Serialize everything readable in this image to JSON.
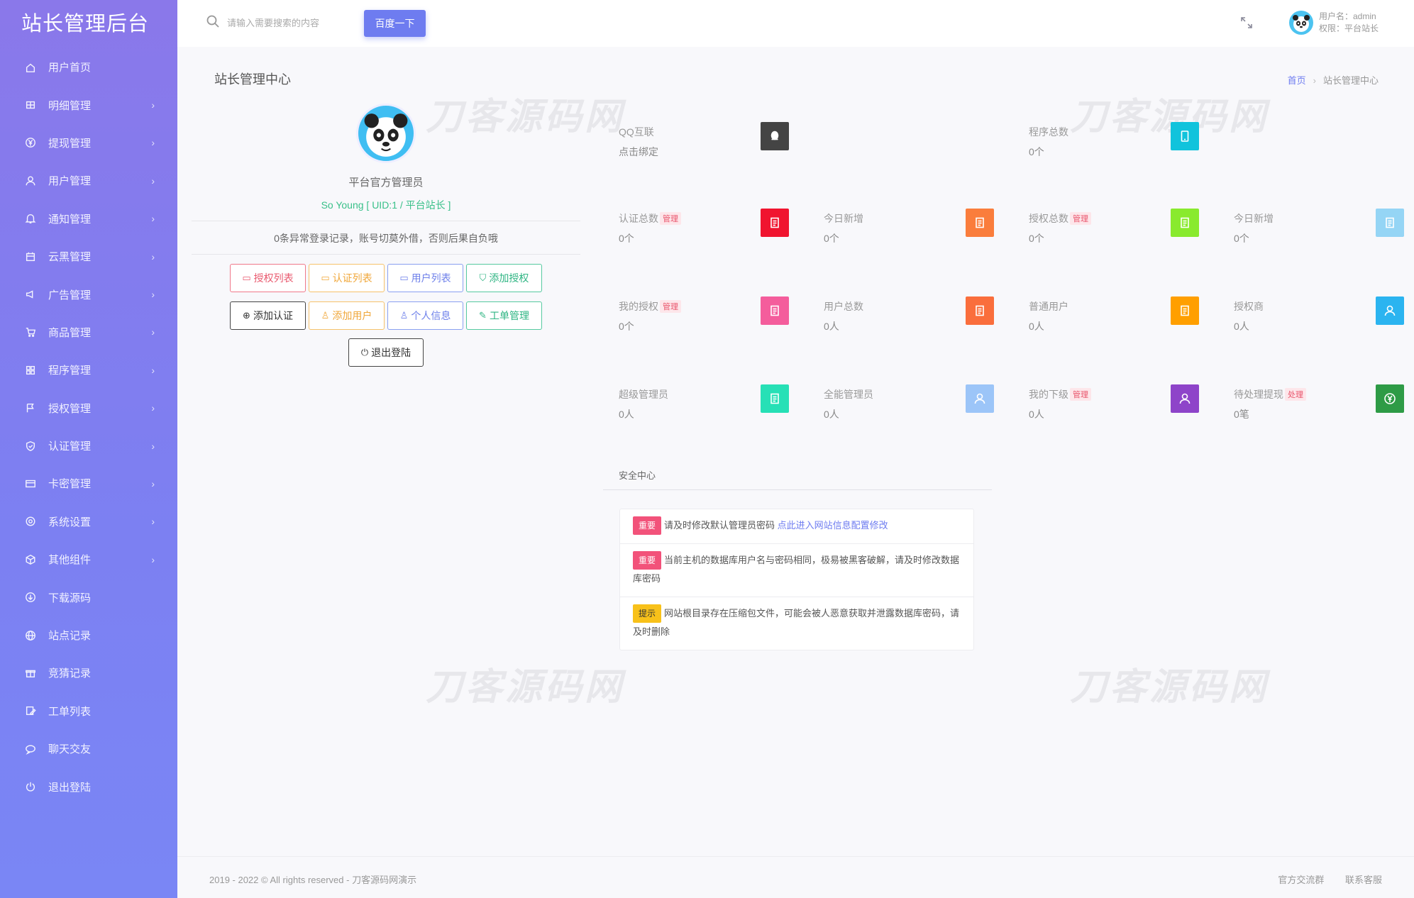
{
  "brand": "站长管理后台",
  "sidebar": {
    "items": [
      {
        "label": "用户首页",
        "icon": "home-icon",
        "arrow": ""
      },
      {
        "label": "明细管理",
        "icon": "grid-icon",
        "arrow": "›"
      },
      {
        "label": "提现管理",
        "icon": "yen-icon",
        "arrow": "›"
      },
      {
        "label": "用户管理",
        "icon": "user-icon",
        "arrow": "›"
      },
      {
        "label": "通知管理",
        "icon": "bell-icon",
        "arrow": "›"
      },
      {
        "label": "云黑管理",
        "icon": "calendar-icon",
        "arrow": "›"
      },
      {
        "label": "广告管理",
        "icon": "megaphone-icon",
        "arrow": "›"
      },
      {
        "label": "商品管理",
        "icon": "cart-icon",
        "arrow": "›"
      },
      {
        "label": "程序管理",
        "icon": "apps-icon",
        "arrow": "›"
      },
      {
        "label": "授权管理",
        "icon": "flag-icon",
        "arrow": "›"
      },
      {
        "label": "认证管理",
        "icon": "shield-icon",
        "arrow": "›"
      },
      {
        "label": "卡密管理",
        "icon": "card-icon",
        "arrow": "›"
      },
      {
        "label": "系统设置",
        "icon": "gear-icon",
        "arrow": "›"
      },
      {
        "label": "其他组件",
        "icon": "box-icon",
        "arrow": "›"
      },
      {
        "label": "下载源码",
        "icon": "download-icon",
        "arrow": ""
      },
      {
        "label": "站点记录",
        "icon": "globe-icon",
        "arrow": ""
      },
      {
        "label": "竞猜记录",
        "icon": "gift-icon",
        "arrow": ""
      },
      {
        "label": "工单列表",
        "icon": "edit-icon",
        "arrow": ""
      },
      {
        "label": "聊天交友",
        "icon": "chat-icon",
        "arrow": ""
      },
      {
        "label": "退出登陆",
        "icon": "power-icon",
        "arrow": ""
      }
    ]
  },
  "header": {
    "search_placeholder": "请输入需要搜索的内容",
    "search_button": "百度一下",
    "username": "用户名：admin",
    "role": "权限：平台站长"
  },
  "page": {
    "title": "站长管理中心",
    "breadcrumb_home": "首页",
    "breadcrumb_sep": "›",
    "breadcrumb_current": "站长管理中心"
  },
  "watermark": "刀客源码网",
  "profile": {
    "name": "平台官方管理员",
    "sub": "So Young [ UID:1 / 平台站长 ]",
    "notice": "0条异常登录记录，账号切莫外借，否则后果自负哦",
    "buttons": [
      {
        "label": "授权列表",
        "icon": "file-icon",
        "glyph": "▭",
        "color": "red"
      },
      {
        "label": "认证列表",
        "icon": "file-icon",
        "glyph": "▭",
        "color": "orange"
      },
      {
        "label": "用户列表",
        "icon": "file-icon",
        "glyph": "▭",
        "color": "blue"
      },
      {
        "label": "添加授权",
        "icon": "shield-check-icon",
        "glyph": "⛉",
        "color": "green"
      },
      {
        "label": "添加认证",
        "icon": "plus-circle-icon",
        "glyph": "⊕",
        "color": "dark"
      },
      {
        "label": "添加用户",
        "icon": "user-icon",
        "glyph": "♙",
        "color": "orange"
      },
      {
        "label": "个人信息",
        "icon": "user-icon",
        "glyph": "♙",
        "color": "blue"
      },
      {
        "label": "工单管理",
        "icon": "edit-icon",
        "glyph": "✎",
        "color": "green"
      }
    ],
    "logout": "退出登陆"
  },
  "stats": [
    {
      "label": "QQ互联",
      "tag": "",
      "value": "点击绑定",
      "color": "#444444",
      "icon": "qq-icon"
    },
    {
      "label": "程序总数",
      "tag": "",
      "value": "0个",
      "color": "#11c3dc",
      "icon": "tablet-icon"
    },
    {
      "label": "认证总数",
      "tag": "管理",
      "value": "0个",
      "color": "#f0142f",
      "icon": "doc-icon"
    },
    {
      "label": "今日新增",
      "tag": "",
      "value": "0个",
      "color": "#fa7d3c",
      "icon": "doc-icon"
    },
    {
      "label": "授权总数",
      "tag": "管理",
      "value": "0个",
      "color": "#89ea2e",
      "icon": "doc-icon"
    },
    {
      "label": "今日新增",
      "tag": "",
      "value": "0个",
      "color": "#95d5f5",
      "icon": "doc-icon"
    },
    {
      "label": "我的授权",
      "tag": "管理",
      "value": "0个",
      "color": "#f45d9c",
      "icon": "doc-icon"
    },
    {
      "label": "用户总数",
      "tag": "",
      "value": "0人",
      "color": "#fa6e3c",
      "icon": "doc-icon"
    },
    {
      "label": "普通用户",
      "tag": "",
      "value": "0人",
      "color": "#ff9f00",
      "icon": "doc-icon"
    },
    {
      "label": "授权商",
      "tag": "",
      "value": "0人",
      "color": "#2bb4f0",
      "icon": "user-icon"
    },
    {
      "label": "超级管理员",
      "tag": "",
      "value": "0人",
      "color": "#27e0b6",
      "icon": "doc-icon"
    },
    {
      "label": "全能管理员",
      "tag": "",
      "value": "0人",
      "color": "#9cc5f8",
      "icon": "user-icon"
    },
    {
      "label": "我的下级",
      "tag": "管理",
      "value": "0人",
      "color": "#8e44c9",
      "icon": "user-icon"
    },
    {
      "label": "待处理提现",
      "tag": "处理",
      "value": "0笔",
      "color": "#2e9b46",
      "icon": "yen-icon"
    }
  ],
  "security": {
    "title": "安全中心",
    "items": [
      {
        "badge": "重要",
        "text": "请及时修改默认管理员密码 ",
        "link": "点此进入网站信息配置修改"
      },
      {
        "badge": "重要",
        "text": "当前主机的数据库用户名与密码相同，极易被黑客破解，请及时修改数据库密码",
        "link": ""
      },
      {
        "badge": "提示",
        "text": "网站根目录存在压缩包文件，可能会被人恶意获取并泄露数据库密码，请及时删除",
        "link": ""
      }
    ]
  },
  "footer": {
    "copyright": "2019 - 2022 © All rights reserved - 刀客源码网演示",
    "link1": "官方交流群",
    "link2": "联系客服"
  }
}
